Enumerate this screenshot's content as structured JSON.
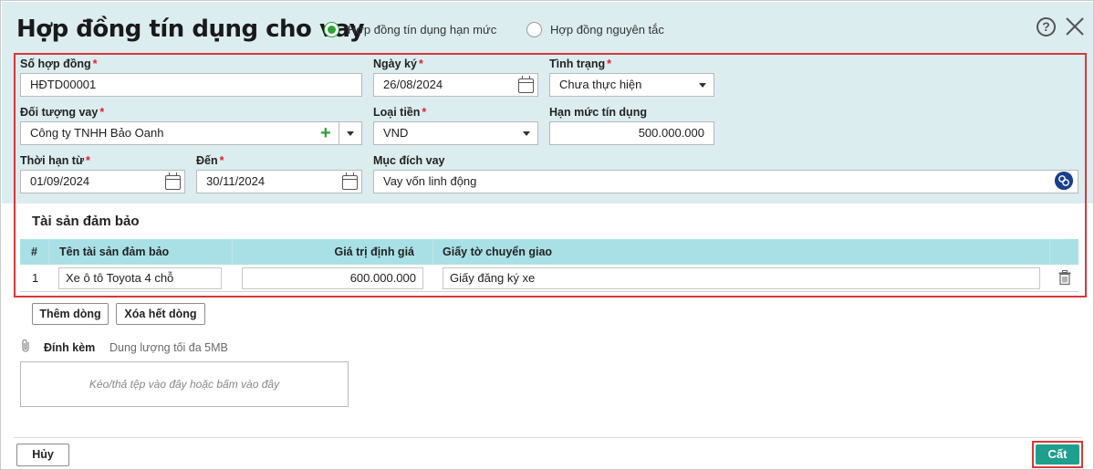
{
  "dialog": {
    "title": "Hợp đồng tín dụng cho vay",
    "contract_types": [
      {
        "label": "Hợp đồng tín dụng hạn mức",
        "selected": true
      },
      {
        "label": "Hợp đồng nguyên tắc",
        "selected": false
      }
    ],
    "help_icon": "?"
  },
  "form": {
    "contract_no": {
      "label": "Số hợp đồng",
      "required": "*",
      "value": "HĐTD00001"
    },
    "sign_date": {
      "label": "Ngày ký",
      "required": "*",
      "value": "26/08/2024"
    },
    "status": {
      "label": "Tình trạng",
      "required": "*",
      "value": "Chưa thực hiện"
    },
    "borrower": {
      "label": "Đối tượng vay",
      "required": "*",
      "value": "Công ty TNHH Bảo Oanh"
    },
    "currency": {
      "label": "Loại tiền",
      "required": "*",
      "value": "VND"
    },
    "credit_limit": {
      "label": "Hạn mức tín dụng",
      "value": "500.000.000"
    },
    "term_from": {
      "label": "Thời hạn từ",
      "required": "*",
      "value": "01/09/2024"
    },
    "term_to": {
      "label": "Đến",
      "required": "*",
      "value": "30/11/2024"
    },
    "purpose": {
      "label": "Mục đích vay",
      "value": "Vay vốn linh động"
    }
  },
  "collateral": {
    "section_title": "Tài sản đảm bảo",
    "columns": [
      "#",
      "Tên tài sản đảm bảo",
      "Giá trị định giá",
      "Giấy tờ chuyển giao"
    ],
    "rows": [
      {
        "index": "1",
        "name": "Xe ô tô Toyota 4 chỗ",
        "value": "600.000.000",
        "documents": "Giấy đăng ký xe"
      }
    ],
    "add_row_label": "Thêm dòng",
    "clear_rows_label": "Xóa hết dòng"
  },
  "attachment": {
    "label": "Đính kèm",
    "hint": "Dung lượng tối đa 5MB",
    "drop_text": "Kéo/thả tệp vào đây hoặc bấm vào đây"
  },
  "footer": {
    "cancel_label": "Hủy",
    "save_label": "Cất"
  },
  "colors": {
    "header_bg": "#dcedf0",
    "table_header_bg": "#a8e0e6",
    "highlight_border": "#d9383a",
    "save_button": "#1f9f8d",
    "radio_selected": "#2fa33a"
  }
}
